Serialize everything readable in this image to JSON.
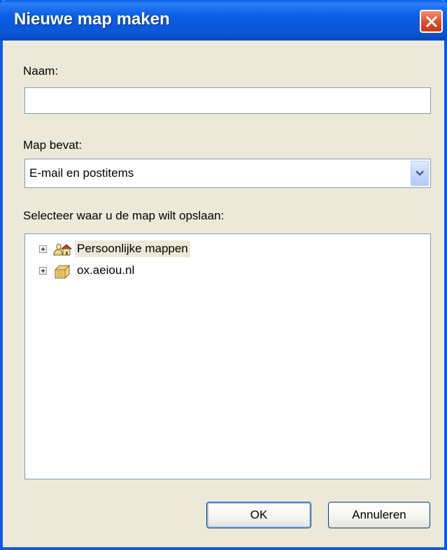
{
  "window": {
    "title": "Nieuwe map maken"
  },
  "name_field": {
    "label": "Naam:",
    "value": "",
    "placeholder": ""
  },
  "contains_field": {
    "label": "Map bevat:",
    "selected": "E-mail en postitems"
  },
  "location": {
    "label": "Selecteer waar u de map wilt opslaan:",
    "items": [
      {
        "label": "Persoonlijke mappen",
        "icon": "personal-folders-icon",
        "selected": true,
        "expandable": true
      },
      {
        "label": "ox.aeiou.nl",
        "icon": "mailbox-icon",
        "selected": false,
        "expandable": true
      }
    ]
  },
  "buttons": {
    "ok": "OK",
    "cancel": "Annuleren"
  },
  "colors": {
    "titlebar": "#0A56D6",
    "dialog_bg": "#ECE9D8",
    "close_red": "#E0502A",
    "field_border": "#7F9DB9"
  }
}
